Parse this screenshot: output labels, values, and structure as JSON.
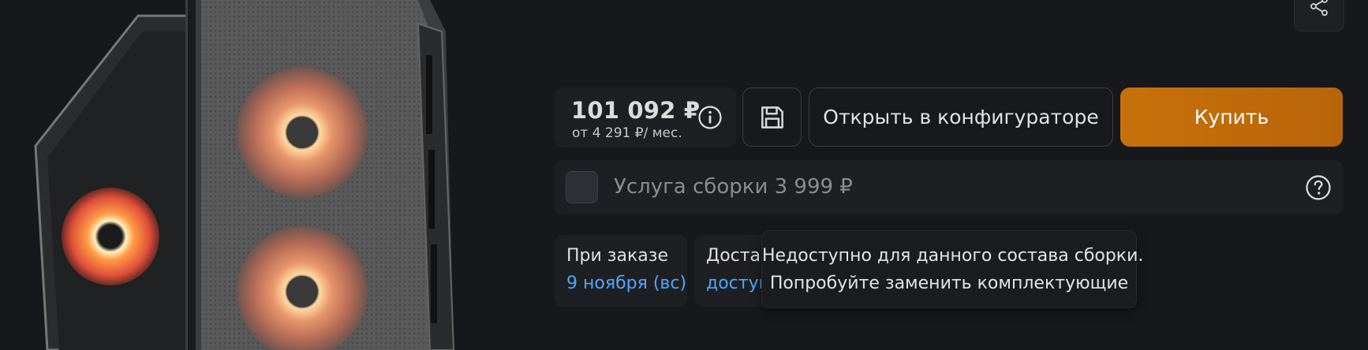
{
  "price": {
    "amount": "101 092 ₽",
    "monthly": "от 4 291 ₽/ мес."
  },
  "actions": {
    "open_configurator_label": "Открыть в конфигураторе",
    "buy_label": "Купить"
  },
  "service": {
    "label": "Услуга сборки 3 999 ₽",
    "checked": false
  },
  "order_info": {
    "title": "При заказе",
    "date": "9 ноября (вс)"
  },
  "delivery_info": {
    "title": "Достав",
    "link": "доступ"
  },
  "tooltip": {
    "line1": "Недоступно для данного состава сборки.",
    "line2": "Попробуйте заменить комплектующие"
  },
  "icons": {
    "share": "share-icon",
    "info": "info-icon",
    "save": "save-icon",
    "help": "question-icon"
  },
  "colors": {
    "background": "#16181b",
    "panel": "#1d1f22",
    "accent_buy": "#c7710b",
    "link": "#4ea7ff"
  }
}
